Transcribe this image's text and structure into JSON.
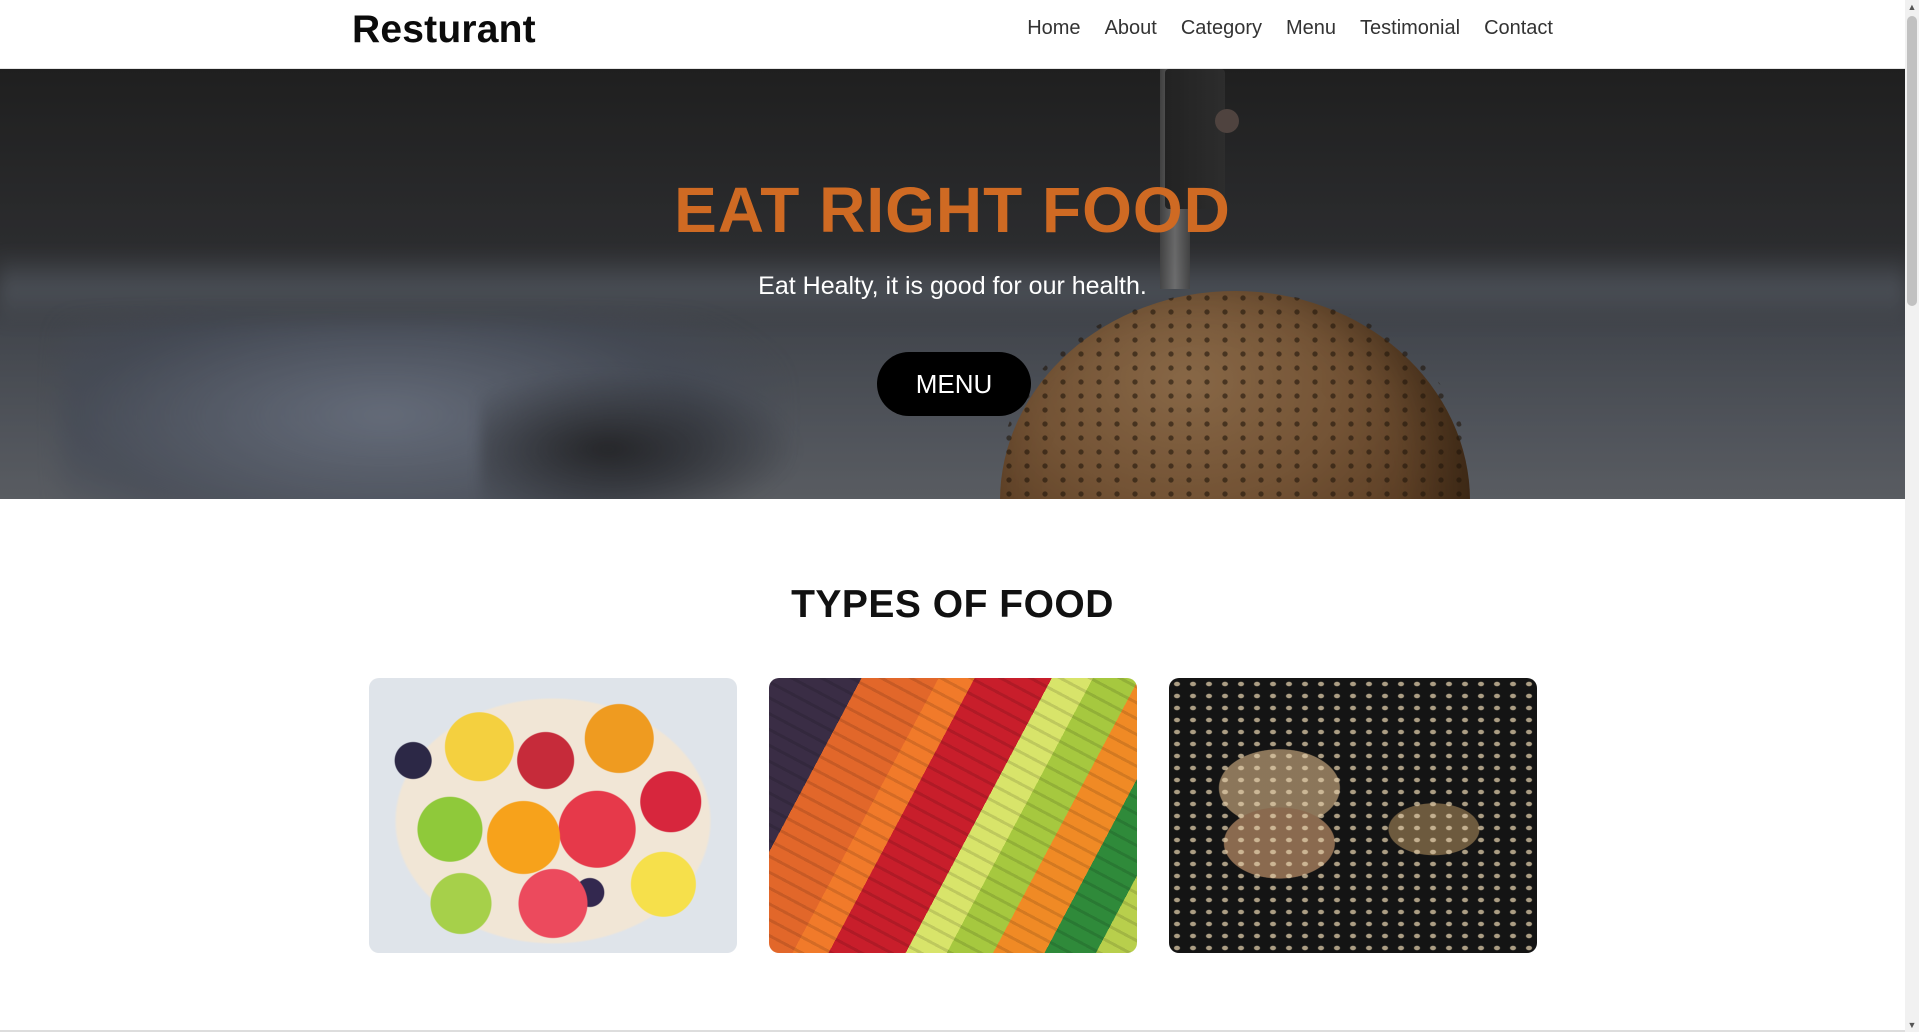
{
  "nav": {
    "brand": "Resturant",
    "links": [
      "Home",
      "About",
      "Category",
      "Menu",
      "Testimonial",
      "Contact"
    ]
  },
  "hero": {
    "title": "EAT RIGHT FOOD",
    "subtitle": "Eat Healty, it is good for our health.",
    "button": "MENU",
    "title_color": "#cf6a23"
  },
  "section": {
    "title": "TYPES OF FOOD",
    "cards": [
      "fruits-image",
      "vegetables-image",
      "grains-image"
    ]
  },
  "scrollbar": {
    "up_icon": "scroll-up-arrow-icon",
    "down_icon": "scroll-down-arrow-icon"
  }
}
